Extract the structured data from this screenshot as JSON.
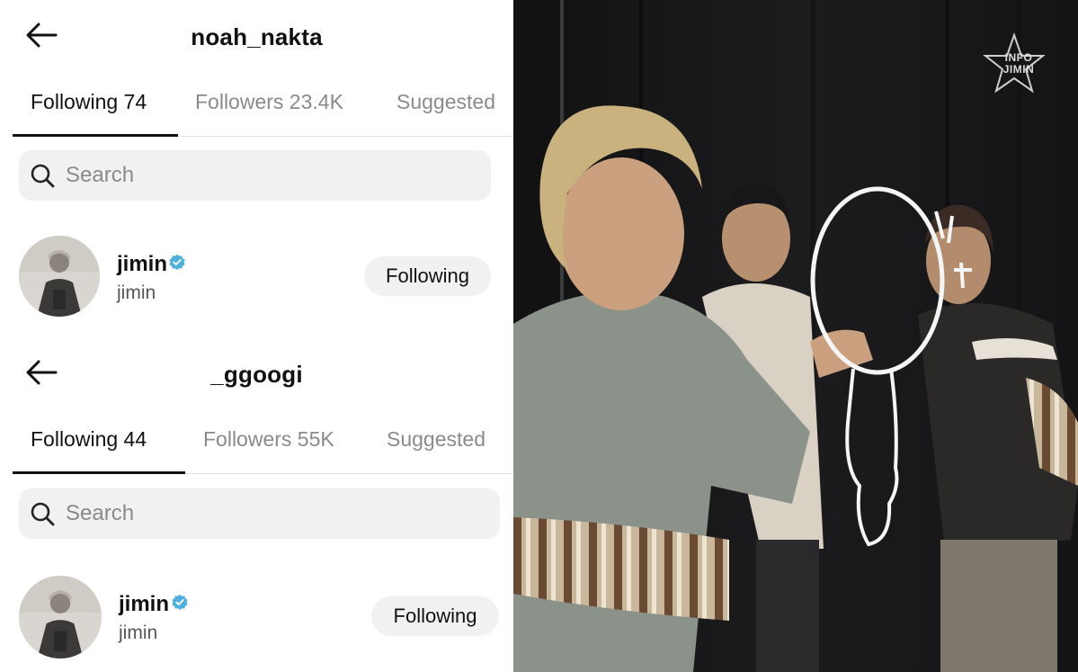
{
  "panels": [
    {
      "title": "noah_nakta",
      "tabs": [
        {
          "label": "Following 74",
          "active": true
        },
        {
          "label": "Followers 23.4K",
          "active": false
        },
        {
          "label": "Suggested",
          "active": false
        }
      ],
      "search_placeholder": "Search",
      "user": {
        "name": "jimin",
        "handle": "jimin",
        "verified": true,
        "button": "Following"
      }
    },
    {
      "title": "_ggoogi",
      "tabs": [
        {
          "label": "Following 44",
          "active": true
        },
        {
          "label": "Followers 55K",
          "active": false
        },
        {
          "label": "Suggested",
          "active": false
        }
      ],
      "search_placeholder": "Search",
      "user": {
        "name": "jimin",
        "handle": "jimin",
        "verified": true,
        "button": "Following"
      }
    }
  ],
  "photo": {
    "watermark": "INFO JIMIN",
    "watermark_lines": [
      "INFO",
      "JIMIN"
    ]
  },
  "colors": {
    "verified": "#4fb0d9",
    "tab_active": "#111111",
    "tab_inactive": "#8a8a8a",
    "pill_bg": "#f1f1f2"
  }
}
